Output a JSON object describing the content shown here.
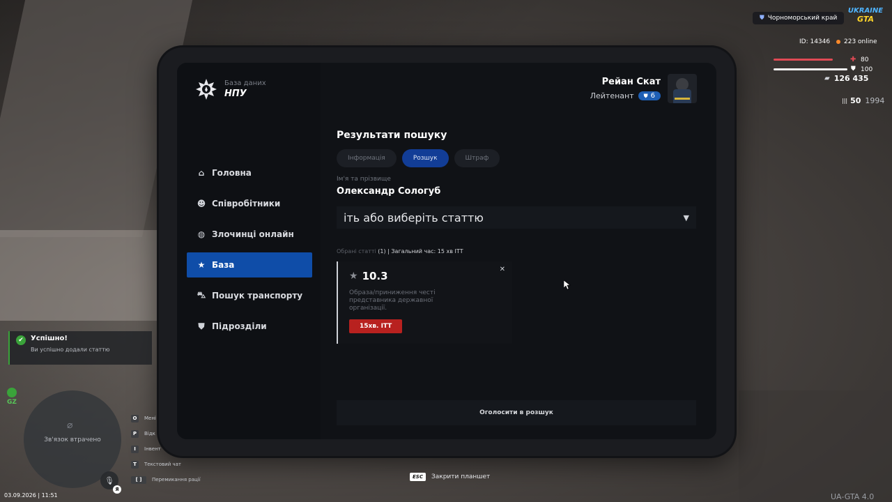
{
  "app": {
    "logo_sub": "База даних",
    "logo_main": "НПУ"
  },
  "profile": {
    "name": "Рейан Скат",
    "rank": "Лейтенант",
    "rank_level": "6"
  },
  "sidebar": {
    "items": [
      {
        "label": "Головна",
        "icon": "home-icon"
      },
      {
        "label": "Співробітники",
        "icon": "users-icon"
      },
      {
        "label": "Злочинці онлайн",
        "icon": "criminal-icon"
      },
      {
        "label": "База",
        "icon": "star-icon",
        "active": true
      },
      {
        "label": "Пошук транспорту",
        "icon": "car-icon"
      },
      {
        "label": "Підрозділи",
        "icon": "shield-icon"
      }
    ]
  },
  "main": {
    "title": "Результати пошуку",
    "tabs": [
      {
        "label": "Інформація"
      },
      {
        "label": "Розшук",
        "active": true
      },
      {
        "label": "Штраф"
      }
    ],
    "name_label": "Ім'я та прізвище",
    "name_value": "Олександр Сологуб",
    "article_select_value": "іть або виберіть статтю",
    "chosen_label": "Обрані статті",
    "chosen_count": "(1)",
    "total_time": "| Загальний час: 15 хв ІТТ",
    "article": {
      "number": "10.3",
      "description": "Образа/приниження честі представника державної організації.",
      "badge": "15хв. ІТТ"
    },
    "action_button": "Оголосити в розшук"
  },
  "hint": {
    "key": "ESC",
    "text": "Закрити планшет"
  },
  "hud": {
    "region": "Чорноморський край",
    "brand_line1": "UKRAINE",
    "brand_line2": "GTA",
    "player_id": "ID: 14346",
    "online": "223 online",
    "health": "80",
    "armor": "100",
    "health_fraction": 0.8,
    "armor_fraction": 1.0,
    "money": "126 435",
    "ammo_current": "50",
    "ammo_total": "1994",
    "gz": "GZ",
    "minimap_status": "Зв'язок втрачено",
    "datetime": "03.09.2026 | 11:51",
    "version": "UA-GTA 4.0",
    "mic_badge": "Я",
    "keys": [
      {
        "key": "O",
        "label": "Мені"
      },
      {
        "key": "P",
        "label": "Відк"
      },
      {
        "key": "I",
        "label": "Інвент"
      },
      {
        "key": "T",
        "label": "Текстовий чат"
      },
      {
        "key": "[ ]",
        "label": "Перемикання рації"
      }
    ]
  },
  "notification": {
    "title": "Успішно!",
    "text": "Ви успішно додали статтю"
  },
  "colors": {
    "accent": "#0f4da8",
    "tab_active": "#123d96",
    "danger": "#b8211f",
    "success": "#3aa33a",
    "health": "#e04a55"
  }
}
